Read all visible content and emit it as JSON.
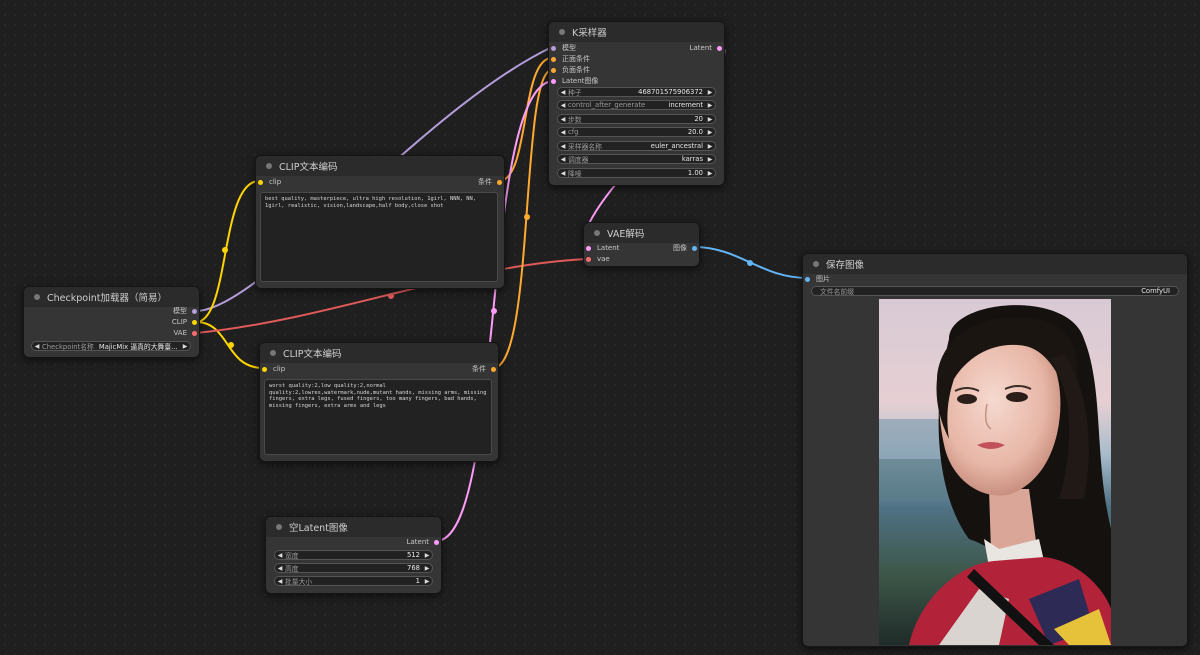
{
  "nodes": {
    "ksampler": {
      "title": "K采样器",
      "inputs": [
        "模型",
        "正面条件",
        "负面条件",
        "Latent图像"
      ],
      "output": "Latent",
      "widgets": [
        {
          "label": "种子",
          "value": "468701575906372"
        },
        {
          "label": "control_after_generate",
          "value": "increment"
        },
        {
          "label": "步数",
          "value": "20"
        },
        {
          "label": "cfg",
          "value": "20.0"
        },
        {
          "label": "采样器名称",
          "value": "euler_ancestral"
        },
        {
          "label": "调度器",
          "value": "karras"
        },
        {
          "label": "降噪",
          "value": "1.00"
        }
      ]
    },
    "clip_pos": {
      "title": "CLIP文本编码",
      "input": "clip",
      "output": "条件",
      "text": "best quality, masterpiece, ultra high resolution, 1girl, NNN, NN, 1girl, realistic, vision,landscape,half body,close shot"
    },
    "clip_neg": {
      "title": "CLIP文本编码",
      "input": "clip",
      "output": "条件",
      "text": "worst quality:2,low quality:2,normal quality:2,lowres,watermark,nude,mutant hands, missing arms, missing fingers, extra legs, fused fingers, too many fingers, bad hands, missing fingers, extra arms and legs"
    },
    "checkpoint": {
      "title": "Checkpoint加载器（简易）",
      "outputs": [
        "模型",
        "CLIP",
        "VAE"
      ],
      "widget": {
        "label": "Checkpoint名称",
        "value": "MajicMix 逼真的大舞臺..."
      }
    },
    "vae_decode": {
      "title": "VAE解码",
      "inputs": [
        "Latent",
        "vae"
      ],
      "output": "图像"
    },
    "empty_latent": {
      "title": "空Latent图像",
      "output": "Latent",
      "widgets": [
        {
          "label": "宽度",
          "value": "512"
        },
        {
          "label": "高度",
          "value": "768"
        },
        {
          "label": "批量大小",
          "value": "1"
        }
      ]
    },
    "save_image": {
      "title": "保存图像",
      "input": "图片",
      "widget": {
        "label": "文件名前缀",
        "value": "ComfyUI"
      }
    }
  },
  "colors": {
    "model": "#b39ddb",
    "clip": "#ffd500",
    "vae": "#ff6e6e",
    "conditioning": "#ffa931",
    "latent": "#ff9cf9",
    "image": "#64b5f6"
  }
}
